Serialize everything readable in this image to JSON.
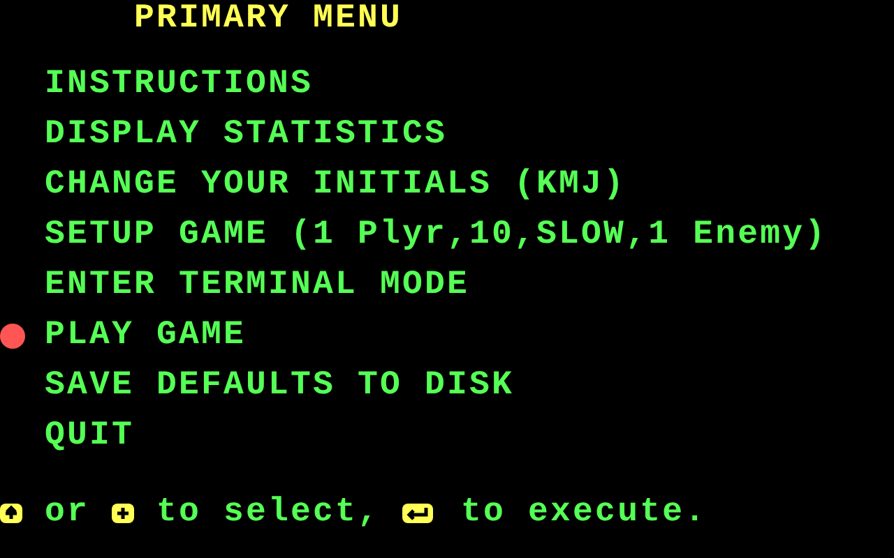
{
  "title": "PRIMARY MENU",
  "menu": [
    {
      "label": "INSTRUCTIONS",
      "selected": false
    },
    {
      "label": "DISPLAY STATISTICS",
      "selected": false
    },
    {
      "label": "CHANGE YOUR INITIALS (KMJ)",
      "selected": false
    },
    {
      "label": "SETUP GAME (1 Plyr,10,SLOW,1 Enemy)",
      "selected": false
    },
    {
      "label": "ENTER TERMINAL MODE",
      "selected": false
    },
    {
      "label": "PLAY GAME",
      "selected": true
    },
    {
      "label": "SAVE DEFAULTS TO DISK",
      "selected": false
    },
    {
      "label": "QUIT",
      "selected": false
    }
  ],
  "footer": [
    {
      "kind": "key-up"
    },
    {
      "kind": "text",
      "text": "or"
    },
    {
      "kind": "key-down"
    },
    {
      "kind": "text",
      "text": "to select,"
    },
    {
      "kind": "key-enter"
    },
    {
      "kind": "text",
      "text": "to execute."
    }
  ]
}
